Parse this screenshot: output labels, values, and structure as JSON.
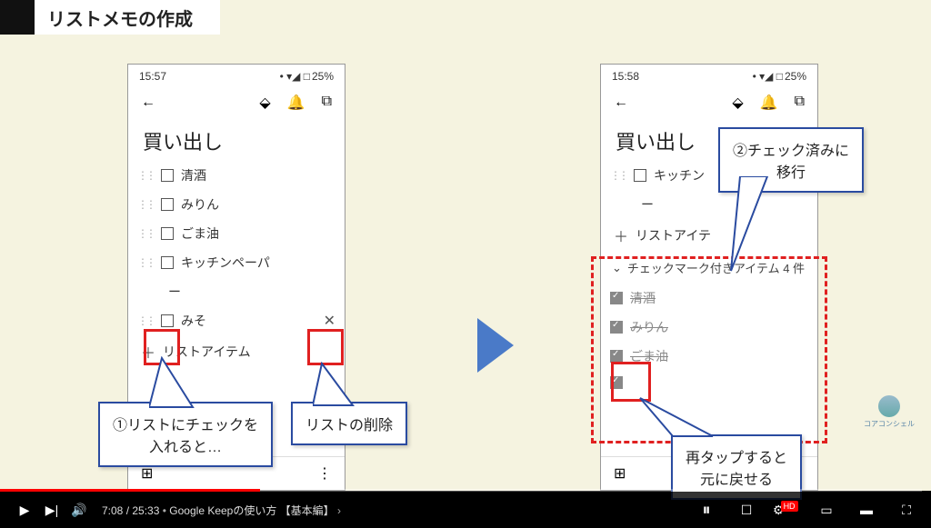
{
  "header": {
    "title": "リストメモの作成"
  },
  "phone_left": {
    "time": "15:57",
    "battery": "25%",
    "list_title": "買い出し",
    "items": [
      {
        "text": "清酒"
      },
      {
        "text": "みりん"
      },
      {
        "text": "ごま油"
      },
      {
        "text": "キッチンペーパ"
      },
      {
        "text": "ー"
      },
      {
        "text": "みそ",
        "active": true
      }
    ],
    "add_item": "リストアイテム"
  },
  "phone_right": {
    "time": "15:58",
    "battery": "25%",
    "list_title": "買い出し",
    "items": [
      {
        "text": "キッチン"
      },
      {
        "text": "ー"
      }
    ],
    "add_item": "リストアイテ",
    "checked_header": "チェックマーク付きアイテム 4 件",
    "checked_items": [
      {
        "text": "清酒"
      },
      {
        "text": "みりん"
      },
      {
        "text": "ごま油"
      },
      {
        "text": ""
      }
    ]
  },
  "callouts": {
    "c1": "①リストにチェックを\n入れると…",
    "c2": "リストの削除",
    "c3": "②チェック済みに\n移行",
    "c4": "再タップすると\n元に戻せる"
  },
  "logo_text": "コアコンシェル",
  "player": {
    "current": "7:08",
    "total": "25:33",
    "chapter": "Google Keepの使い方 【基本編】",
    "hd": "HD"
  }
}
